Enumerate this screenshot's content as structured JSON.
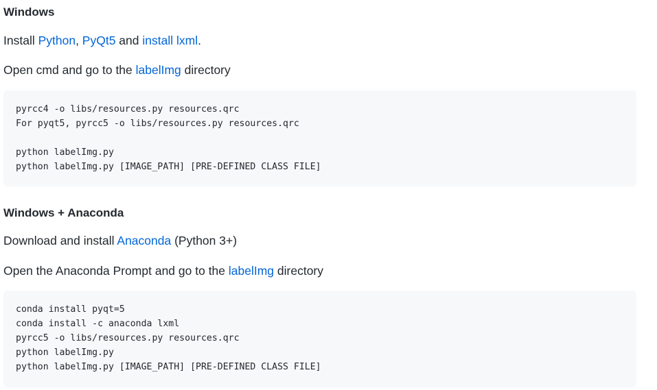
{
  "windows": {
    "heading": "Windows",
    "install": {
      "prefix": "Install ",
      "python_link": "Python",
      "comma": ", ",
      "pyqt5_link": "PyQt5",
      "and": " and ",
      "lxml_link": "install lxml",
      "period": "."
    },
    "open_cmd": {
      "prefix": "Open cmd and go to the ",
      "labelimg_link": "labelImg",
      "suffix": " directory"
    },
    "code": [
      "pyrcc4 -o libs/resources.py resources.qrc",
      "For pyqt5, pyrcc5 -o libs/resources.py resources.qrc",
      "",
      "python labelImg.py",
      "python labelImg.py [IMAGE_PATH] [PRE-DEFINED CLASS FILE]"
    ]
  },
  "anaconda": {
    "heading": "Windows + Anaconda",
    "download": {
      "prefix": "Download and install ",
      "anaconda_link": "Anaconda",
      "suffix": " (Python 3+)"
    },
    "open_prompt": {
      "prefix": "Open the Anaconda Prompt and go to the ",
      "labelimg_link": "labelImg",
      "suffix": " directory"
    },
    "code": [
      "conda install pyqt=5",
      "conda install -c anaconda lxml",
      "pyrcc5 -o libs/resources.py resources.qrc",
      "python labelImg.py",
      "python labelImg.py [IMAGE_PATH] [PRE-DEFINED CLASS FILE]"
    ]
  },
  "colors": {
    "text": "#24292e",
    "link": "#0366d6",
    "code_background": "#f6f8fa"
  }
}
